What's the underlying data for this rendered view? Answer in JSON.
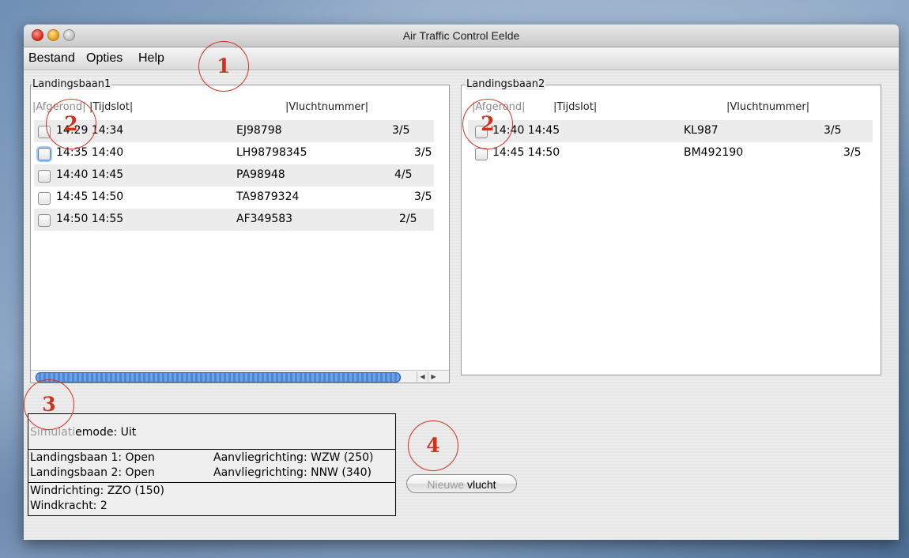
{
  "window": {
    "title": "Air Traffic Control Eelde"
  },
  "menu": [
    "Bestand",
    "Opties",
    "Help"
  ],
  "runways": [
    {
      "title": "Landingsbaan1",
      "headers": [
        "|Afgerond|",
        "|Tijdslot|",
        "|Vluchtnummer|"
      ],
      "rows": [
        {
          "slot": "14:29 14:34",
          "flight": "EJ98798",
          "score": "3/5"
        },
        {
          "slot": "14:35 14:40",
          "flight": "LH98798345",
          "score": "3/5"
        },
        {
          "slot": "14:40 14:45",
          "flight": "PA98948",
          "score": "4/5"
        },
        {
          "slot": "14:45 14:50",
          "flight": "TA9879324",
          "score": "3/5"
        },
        {
          "slot": "14:50 14:55",
          "flight": "AF349583",
          "score": "2/5"
        }
      ]
    },
    {
      "title": "Landingsbaan2",
      "headers": [
        "|Afgerond|",
        "|Tijdslot|",
        "|Vluchtnummer|"
      ],
      "rows": [
        {
          "slot": "14:40 14:45",
          "flight": "KL987",
          "score": "3/5"
        },
        {
          "slot": "14:45 14:50",
          "flight": "BM492190",
          "score": "3/5"
        }
      ]
    }
  ],
  "status": {
    "simulation_prefix": "Simulati",
    "simulation_suffix": "emode: Uit",
    "runway1": "Landingsbaan 1: Open",
    "runway1_approach": "Aanvliegrichting: WZW (250)",
    "runway2": "Landingsbaan 2: Open",
    "runway2_approach": "Aanvliegrichting: NNW (340)",
    "wind_direction": "Windrichting: ZZO (150)",
    "wind_force": "Windkracht: 2"
  },
  "new_flight_button": {
    "label_dim": "Nieuwe",
    "label": " vlucht"
  },
  "callouts": [
    "1",
    "2",
    "2",
    "3",
    "4"
  ],
  "colors": {
    "callout": "#d2321d",
    "scroll_thumb": "#5a8fdc"
  }
}
